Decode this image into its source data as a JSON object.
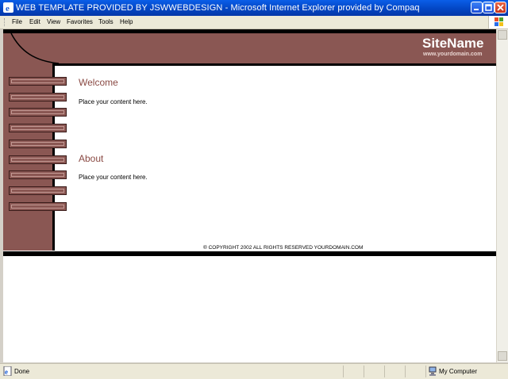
{
  "window": {
    "title": "WEB TEMPLATE PROVIDED BY JSWWEBDESIGN - Microsoft Internet Explorer provided by Compaq"
  },
  "menu": {
    "items": [
      "File",
      "Edit",
      "View",
      "Favorites",
      "Tools",
      "Help"
    ]
  },
  "page": {
    "site_name": "SiteName",
    "site_domain": "www.yourdomain.com",
    "nav_button_count": 9,
    "sections": [
      {
        "heading": "Welcome",
        "text": "Place your content here."
      },
      {
        "heading": "About",
        "text": "Place your content here."
      }
    ],
    "footer": "® COPYRIGHT 2002 ALL RIGHTS RESERVED YOURDOMAIN.COM"
  },
  "status": {
    "text": "Done",
    "zone": "My Computer"
  },
  "colors": {
    "brand": "#8a5753",
    "heading": "#8a4a44",
    "titlebar": "#0346c4"
  },
  "icons": [
    "ie-icon",
    "minimize-icon",
    "maximize-icon",
    "close-icon",
    "windows-logo-icon",
    "page-done-icon",
    "my-computer-icon"
  ]
}
